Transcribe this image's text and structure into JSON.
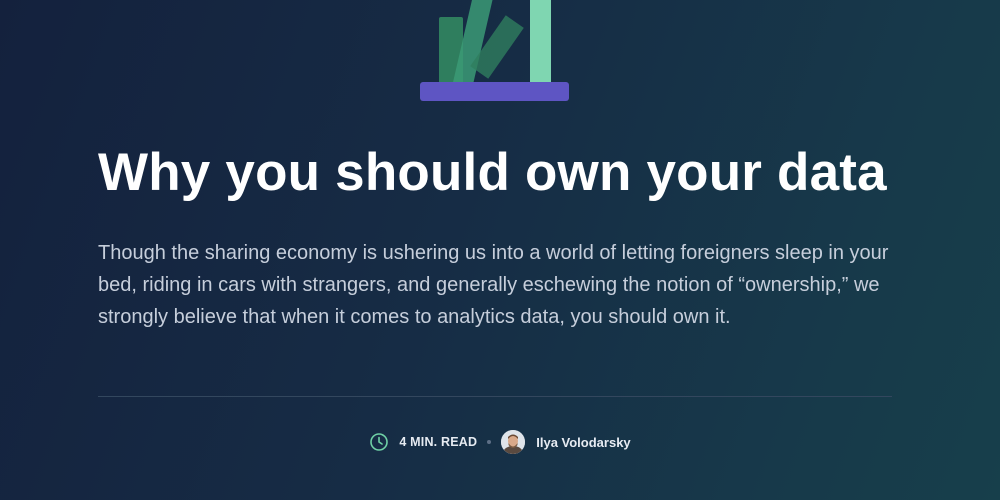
{
  "article": {
    "title": "Why you should own your data",
    "intro": "Though the sharing economy is ushering us into a world of letting foreigners sleep in your bed, riding in cars with strangers, and generally eschewing the notion of “ownership,” we strongly believe that when it comes to analytics data, you should own it."
  },
  "meta": {
    "read_time": "4 MIN. READ",
    "author": "Ilya Volodarsky",
    "clock_icon": "clock-icon",
    "avatar_icon": "author-avatar"
  },
  "colors": {
    "background_start": "#14213d",
    "background_end": "#173f4b",
    "accent_green": "#7fd6b1",
    "accent_purple": "#5e55c3",
    "text_muted": "#c6cedb"
  }
}
